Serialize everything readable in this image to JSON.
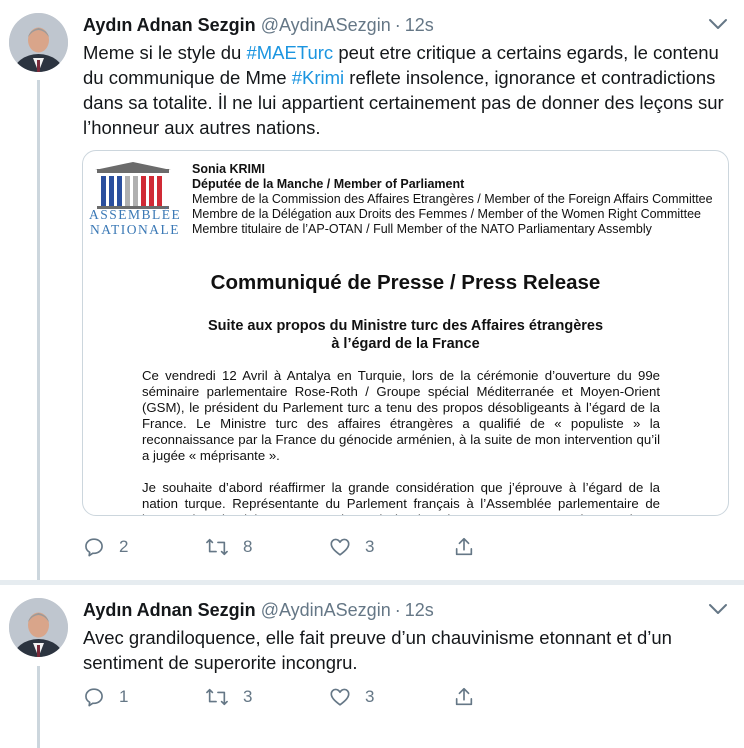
{
  "tweets": [
    {
      "author_name": "Aydın Adnan Sezgin",
      "handle": "@AydinASezgin",
      "separator": "·",
      "time": "12s",
      "text_parts": [
        {
          "t": "Meme si le style du ",
          "tag": false
        },
        {
          "t": "#MAETurc",
          "tag": true
        },
        {
          "t": " peut etre critique a certains egards, le contenu du communique de Mme ",
          "tag": false
        },
        {
          "t": "#Krimi",
          "tag": true
        },
        {
          "t": " reflete insolence, ignorance et contradictions dans sa totalite. İl ne lui appartient certainement pas de donner des leçons sur l’honneur aux autres nations.",
          "tag": false
        }
      ],
      "replies": "2",
      "retweets": "8",
      "likes": "3"
    },
    {
      "author_name": "Aydın Adnan Sezgin",
      "handle": "@AydinASezgin",
      "separator": "·",
      "time": "12s",
      "text_parts": [
        {
          "t": "Avec grandiloquence, elle fait preuve d’un chauvinisme etonnant et d’un sentiment de superorite incongru.",
          "tag": false
        }
      ],
      "replies": "1",
      "retweets": "3",
      "likes": "3"
    }
  ],
  "press_release": {
    "logo_line1": "ASSEMBLÉE",
    "logo_line2": "NATIONALE",
    "name": "Sonia KRIMI",
    "role": "Députée de la Manche / Member of Parliament",
    "lines": [
      "Membre de la Commission des Affaires Etrangères / Member of the Foreign Affairs Committee",
      "Membre de la Délégation aux Droits des Femmes / Member of the Women Right Committee",
      "Membre titulaire de l’AP-OTAN / Full Member of the NATO Parliamentary Assembly"
    ],
    "title": "Communiqué de Presse / Press Release",
    "subtitle_1": "Suite aux propos du Ministre turc des Affaires étrangères",
    "subtitle_2": "à l’égard de la France",
    "paragraph_1": "Ce vendredi 12 Avril à Antalya en Turquie, lors de la cérémonie d’ouverture du 99e séminaire parlementaire Rose-Roth / Groupe spécial Méditerranée et Moyen-Orient (GSM), le président du Parlement turc a tenu des propos désobligeants à l’égard de la France. Le Ministre turc des affaires étrangères a qualifié de « populiste » la reconnaissance par la France du génocide arménien, à la suite de mon intervention qu’il a jugée « méprisante ».",
    "paragraph_2": "Je souhaite d’abord réaffirmer la grande considération que j’éprouve à l’égard de la nation turque. Représentante du Parlement français à l’Assemblée parlementaire de l’OTAN, je suis pleinement consciente de la place importante qu’occupe la Turquie au sein de l’Alliance."
  },
  "icons": {
    "reply": "reply-icon",
    "retweet": "retweet-icon",
    "like": "heart-icon",
    "share": "share-icon",
    "caret": "chevron-down-icon"
  },
  "colors": {
    "hashtag": "#1b95e0",
    "secondary_text": "#657786",
    "border": "#ccd6dd"
  }
}
